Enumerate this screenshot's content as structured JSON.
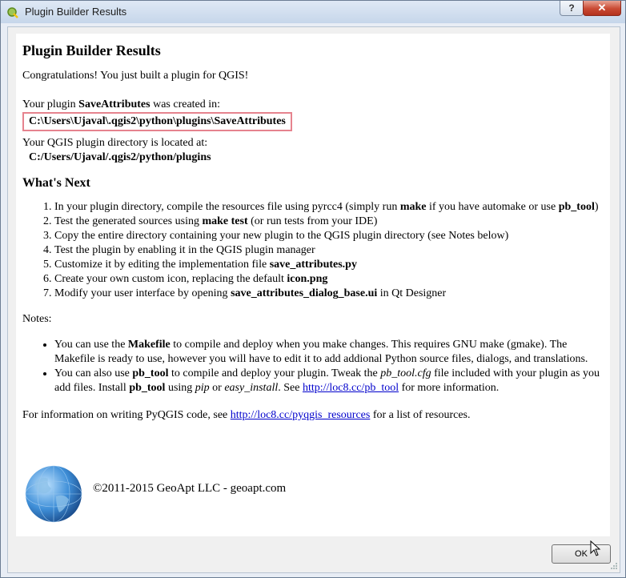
{
  "window": {
    "title": "Plugin Builder Results",
    "help_label": "?",
    "close_label": "✕"
  },
  "content": {
    "heading": "Plugin Builder Results",
    "congrats": "Congratulations! You just built a plugin for QGIS!",
    "created_prefix": "Your plugin ",
    "plugin_name": "SaveAttributes",
    "created_suffix": " was created in:",
    "created_path": "C:\\Users\\Ujaval\\.qgis2\\python\\plugins\\SaveAttributes",
    "dir_label": "Your QGIS plugin directory is located at:",
    "dir_path": "C:/Users/Ujaval/.qgis2/python/plugins",
    "next_heading": "What's Next",
    "steps": [
      {
        "pre": "In your plugin directory, compile the resources file using pyrcc4 (simply run ",
        "b1": "make",
        "mid": " if you have automake or use ",
        "b2": "pb_tool",
        "post": ")"
      },
      {
        "pre": "Test the generated sources using ",
        "b1": "make test",
        "post": " (or run tests from your IDE)"
      },
      {
        "pre": "Copy the entire directory containing your new plugin to the QGIS plugin directory (see Notes below)"
      },
      {
        "pre": "Test the plugin by enabling it in the QGIS plugin manager"
      },
      {
        "pre": "Customize it by editing the implementation file ",
        "b1": "save_attributes.py"
      },
      {
        "pre": "Create your own custom icon, replacing the default ",
        "b1": "icon.png"
      },
      {
        "pre": "Modify your user interface by opening ",
        "b1": "save_attributes_dialog_base.ui",
        "post": " in Qt Designer"
      }
    ],
    "notes_label": "Notes:",
    "notes": [
      {
        "pre": "You can use the ",
        "b1": "Makefile",
        "post": " to compile and deploy when you make changes. This requires GNU make (gmake). The Makefile is ready to use, however you will have to edit it to add addional Python source files, dialogs, and translations."
      },
      {
        "pre": "You can also use ",
        "b1": "pb_tool",
        "mid": " to compile and deploy your plugin. Tweak the ",
        "i1": "pb_tool.cfg",
        "mid2": " file included with your plugin as you add files. Install ",
        "b2": "pb_tool",
        "mid3": " using ",
        "i2": "pip",
        "mid4": " or ",
        "i3": "easy_install",
        "mid5": ". See ",
        "link": "http://loc8.cc/pb_tool",
        "post": " for more information."
      }
    ],
    "info_pre": "For information on writing PyQGIS code, see ",
    "info_link": "http://loc8.cc/pyqgis_resources",
    "info_post": " for a list of resources.",
    "copyright": "©2011-2015 GeoApt LLC - geoapt.com"
  },
  "buttons": {
    "ok": "OK"
  },
  "icons": {
    "app": "qgis-icon",
    "globe": "globe-icon",
    "cursor": "mouse-cursor-icon"
  }
}
